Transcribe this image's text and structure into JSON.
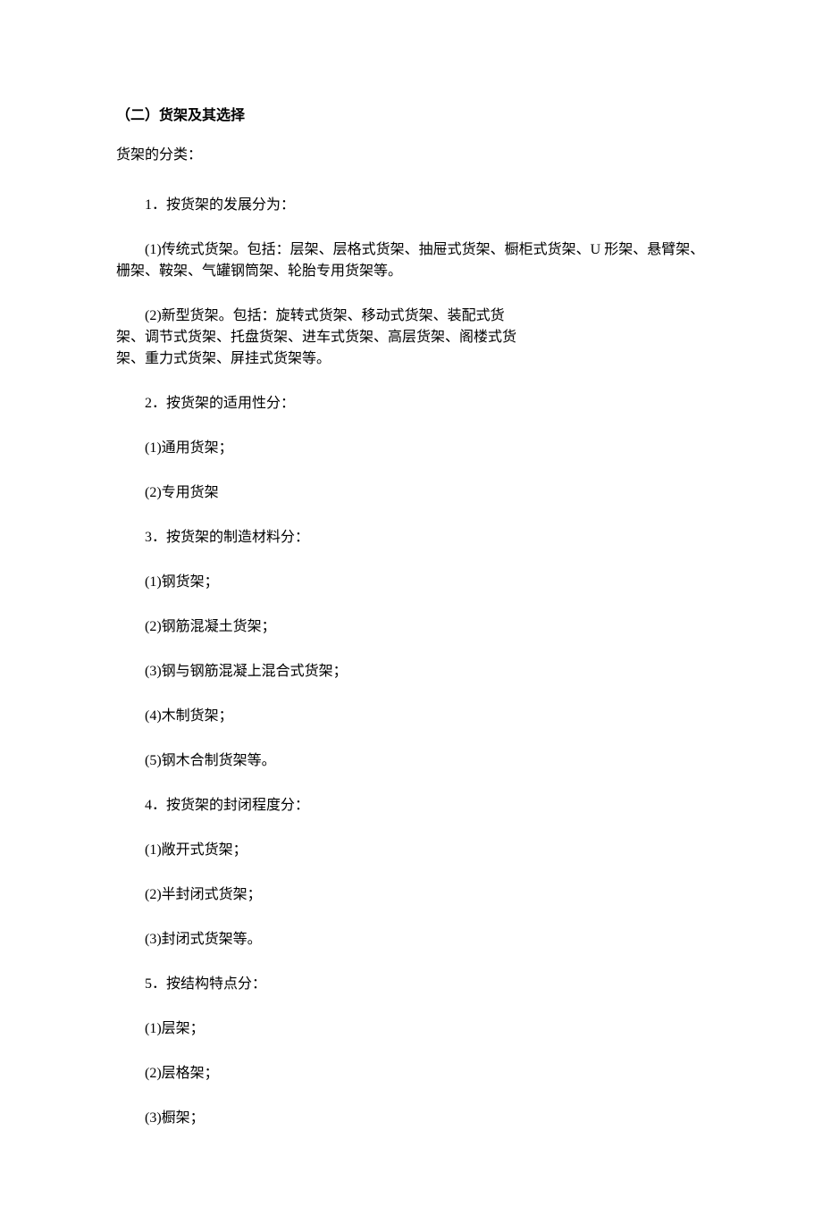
{
  "heading": "（二）货架及其选择",
  "intro": "货架的分类：",
  "paragraphs": [
    "1．按货架的发展分为：",
    "(1)传统式货架。包括：层架、层格式货架、抽屉式货架、橱柜式货架、U 形架、悬臂架、栅架、鞍架、气罐钢筒架、轮胎专用货架等。",
    "(2)新型货架。包括：旋转式货架、移动式货架、装配式货架、调节式货架、托盘货架、进车式货架、高层货架、阁楼式货架、重力式货架、屏挂式货架等。",
    "2．按货架的适用性分：",
    "(1)通用货架；",
    "(2)专用货架",
    "3．按货架的制造材料分：",
    "(1)钢货架；",
    "(2)钢筋混凝土货架；",
    "(3)钢与钢筋混凝上混合式货架；",
    "(4)木制货架；",
    "(5)钢木合制货架等。",
    "4．按货架的封闭程度分：",
    "(1)敞开式货架；",
    "(2)半封闭式货架；",
    "(3)封闭式货架等。",
    "5．按结构特点分：",
    "(1)层架；",
    "(2)层格架；",
    "(3)橱架；"
  ],
  "wrap_limits": {
    "1": 680,
    "2": 460
  }
}
